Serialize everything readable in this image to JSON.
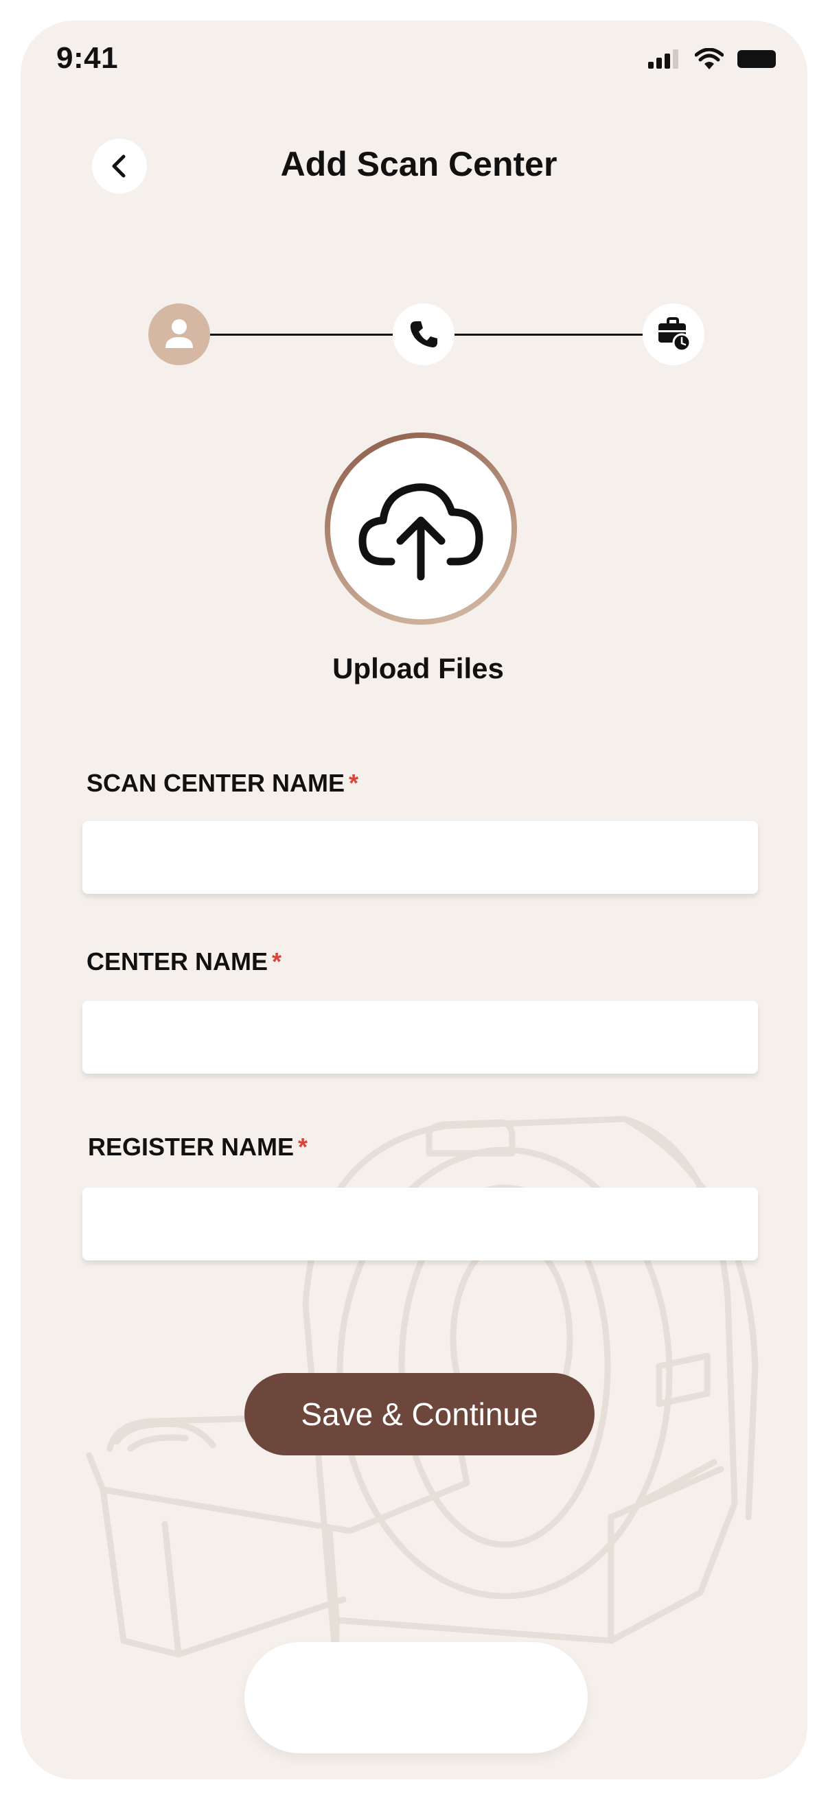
{
  "status_bar": {
    "time": "9:41",
    "icons": [
      "signal-icon",
      "wifi-icon",
      "battery-icon"
    ]
  },
  "header": {
    "back_icon": "chevron-left-icon",
    "title": "Add Scan Center"
  },
  "stepper": {
    "steps": [
      {
        "icon": "user-icon",
        "state": "active"
      },
      {
        "icon": "phone-icon",
        "state": "inactive"
      },
      {
        "icon": "briefcase-clock-icon",
        "state": "inactive"
      }
    ]
  },
  "upload": {
    "icon": "cloud-upload-icon",
    "label": "Upload Files"
  },
  "form": {
    "fields": [
      {
        "label": "SCAN CENTER NAME",
        "required_mark": "*",
        "value": ""
      },
      {
        "label": "CENTER NAME",
        "required_mark": "*",
        "value": ""
      },
      {
        "label": "REGISTER NAME",
        "required_mark": "*",
        "value": ""
      }
    ]
  },
  "actions": {
    "save_label": "Save & Continue"
  },
  "colors": {
    "background": "#f5f0eb",
    "primary_button": "#6e473c",
    "active_step": "#d4b8a3",
    "required": "#d9433b",
    "upload_ring_start": "#8a5a46",
    "upload_ring_end": "#d6bca8"
  }
}
